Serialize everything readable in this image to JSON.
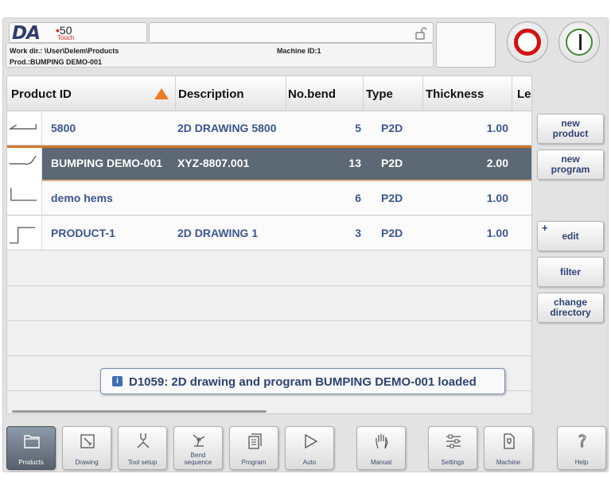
{
  "header": {
    "logo_da": "DA",
    "logo_num": "50",
    "logo_touch": "Touch",
    "workdir": "Work dir.: \\User\\Delem\\Products",
    "product": "Prod.:BUMPING DEMO-001",
    "machine_id": "Machine ID:1"
  },
  "table": {
    "columns": [
      "Product ID",
      "Description",
      "No.bend",
      "Type",
      "Thickness",
      "Le"
    ],
    "rows": [
      {
        "id": "5800",
        "description": "2D DRAWING 5800",
        "bends": "5",
        "type": "P2D",
        "thickness": "1.00",
        "selected": false
      },
      {
        "id": "BUMPING DEMO-001",
        "description": "XYZ-8807.001",
        "bends": "13",
        "type": "P2D",
        "thickness": "2.00",
        "selected": true
      },
      {
        "id": "demo hems",
        "description": "",
        "bends": "6",
        "type": "P2D",
        "thickness": "1.00",
        "selected": false
      },
      {
        "id": "PRODUCT-1",
        "description": "2D DRAWING 1",
        "bends": "3",
        "type": "P2D",
        "thickness": "1.00",
        "selected": false
      }
    ]
  },
  "message": {
    "icon": "i",
    "text": "D1059: 2D drawing and program BUMPING DEMO-001 loaded"
  },
  "side": {
    "new_product": [
      "new",
      "product"
    ],
    "new_program": [
      "new",
      "program"
    ],
    "edit": "edit",
    "edit_plus": "+",
    "filter": "filter",
    "change_directory": [
      "change",
      "directory"
    ]
  },
  "toolbar": [
    {
      "label": "Products",
      "icon": "folder-icon",
      "active": true
    },
    {
      "label": "Drawing",
      "icon": "drawing-icon",
      "active": false
    },
    {
      "label": "Tool setup",
      "icon": "tool-setup-icon",
      "active": false
    },
    {
      "label": "Bend\nsequence",
      "icon": "bend-sequence-icon",
      "active": false
    },
    {
      "label": "Program",
      "icon": "program-icon",
      "active": false
    },
    {
      "label": "Auto",
      "icon": "play-icon",
      "active": false
    },
    {
      "label": "Manual",
      "icon": "hand-icon",
      "active": false
    },
    {
      "label": "Settings",
      "icon": "settings-icon",
      "active": false
    },
    {
      "label": "Machine",
      "icon": "machine-icon",
      "active": false
    },
    {
      "label": "Help",
      "icon": "help-icon",
      "active": false
    }
  ]
}
